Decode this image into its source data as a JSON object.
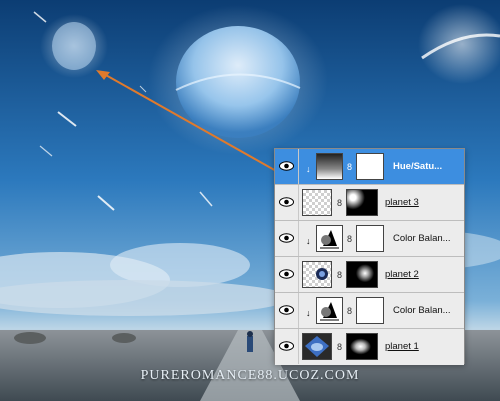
{
  "watermark": "PURERОMANCE88.UCOZ.COM",
  "colors": {
    "selected_row": "#3d8ee0",
    "arrow": "#e07a2c",
    "panel_bg": "#ececec"
  },
  "layers_panel": {
    "layers": [
      {
        "name": "Hue/Satu...",
        "type": "adjustment",
        "clipped": true,
        "selected": true,
        "thumb_icon": "hue-saturation-icon"
      },
      {
        "name": "planet 3",
        "type": "pixel",
        "clipped": false,
        "selected": false,
        "thumb_icon": "planet-3-thumbnail"
      },
      {
        "name": "Color Balan...",
        "type": "adjustment",
        "clipped": true,
        "selected": false,
        "thumb_icon": "color-balance-icon"
      },
      {
        "name": "planet 2",
        "type": "pixel",
        "clipped": false,
        "selected": false,
        "thumb_icon": "planet-2-thumbnail"
      },
      {
        "name": "Color Balan...",
        "type": "adjustment",
        "clipped": true,
        "selected": false,
        "thumb_icon": "color-balance-icon"
      },
      {
        "name": "planet 1",
        "type": "pixel",
        "clipped": false,
        "selected": false,
        "thumb_icon": "planet-1-thumbnail"
      }
    ]
  }
}
